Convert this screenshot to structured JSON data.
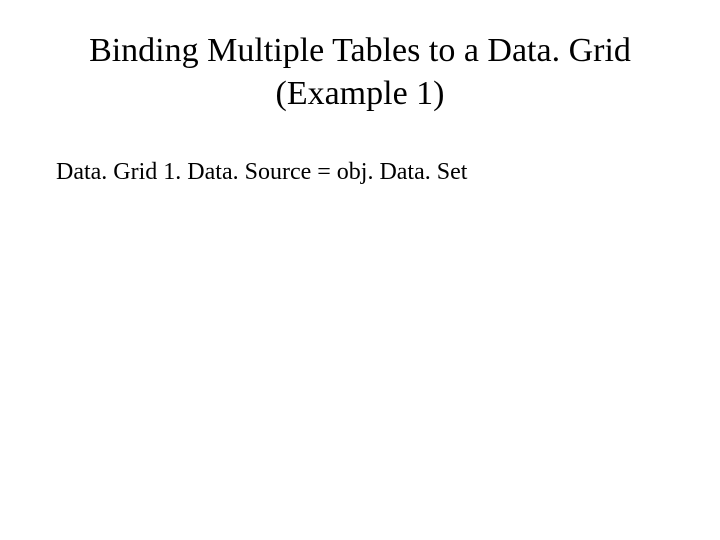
{
  "slide": {
    "title": "Binding Multiple Tables to a Data. Grid (Example 1)",
    "body": "Data. Grid 1. Data. Source = obj. Data. Set"
  }
}
